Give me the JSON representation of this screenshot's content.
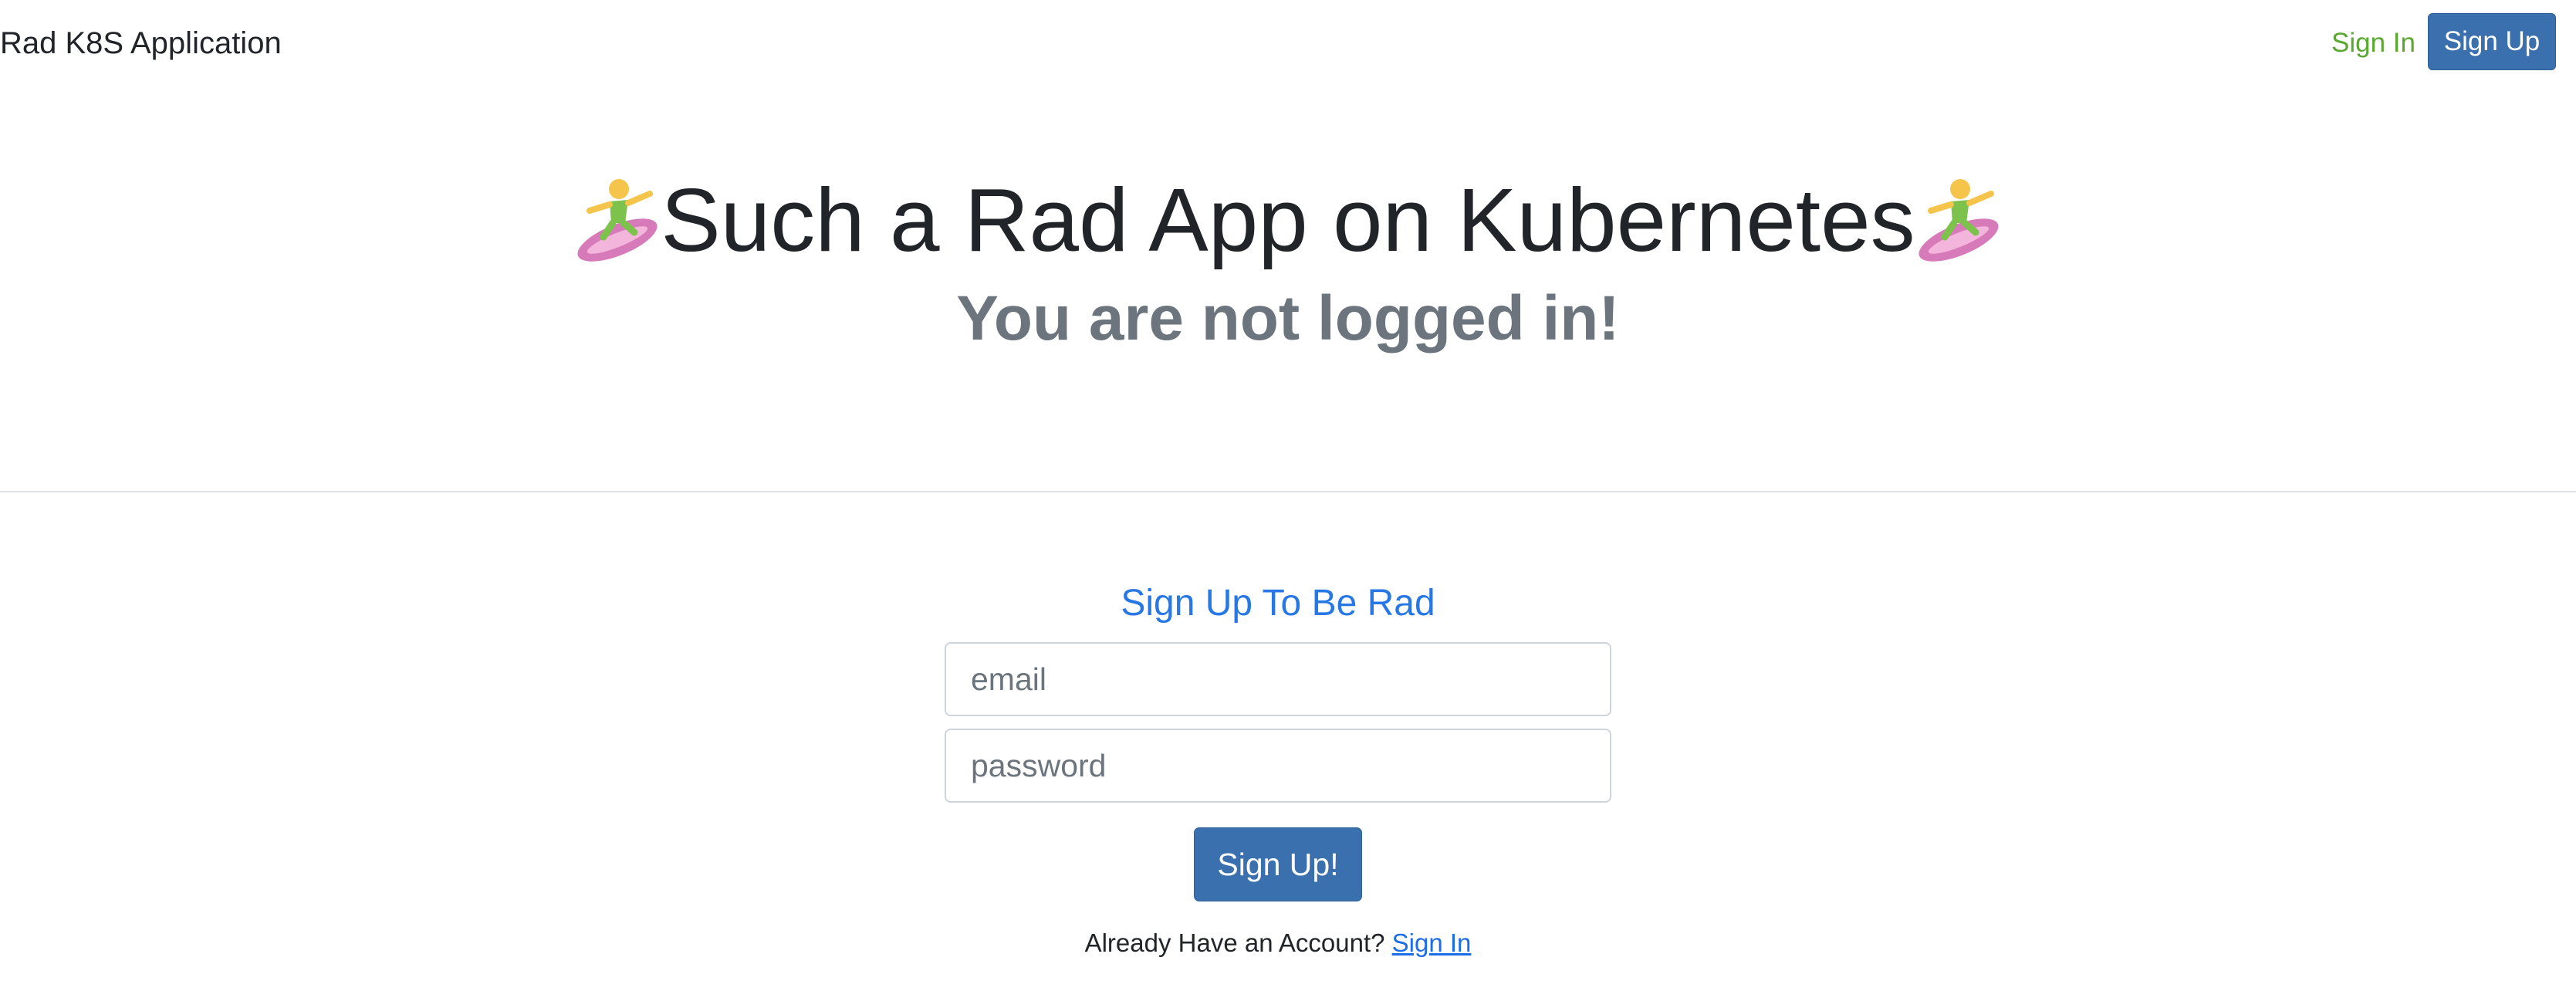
{
  "navbar": {
    "brand": "Rad K8S Application",
    "signin_label": "Sign In",
    "signup_label": "Sign Up"
  },
  "hero": {
    "title": "Such a Rad App on Kubernetes",
    "subtitle": "You are not logged in!",
    "left_icon": "woman-surfing-emoji",
    "right_icon": "woman-surfing-emoji"
  },
  "signup_form": {
    "heading": "Sign Up To Be Rad",
    "email": {
      "value": "",
      "placeholder": "email"
    },
    "password": {
      "value": "",
      "placeholder": "password"
    },
    "submit_label": "Sign Up!",
    "account_prompt": "Already Have an Account?",
    "account_link_label": "Sign In"
  },
  "colors": {
    "primary_button": "#3a70ad",
    "nav_signin": "#5aa832",
    "heading_blue": "#2778e4",
    "link_blue": "#1c6ee8",
    "muted_text": "#6c757d"
  }
}
